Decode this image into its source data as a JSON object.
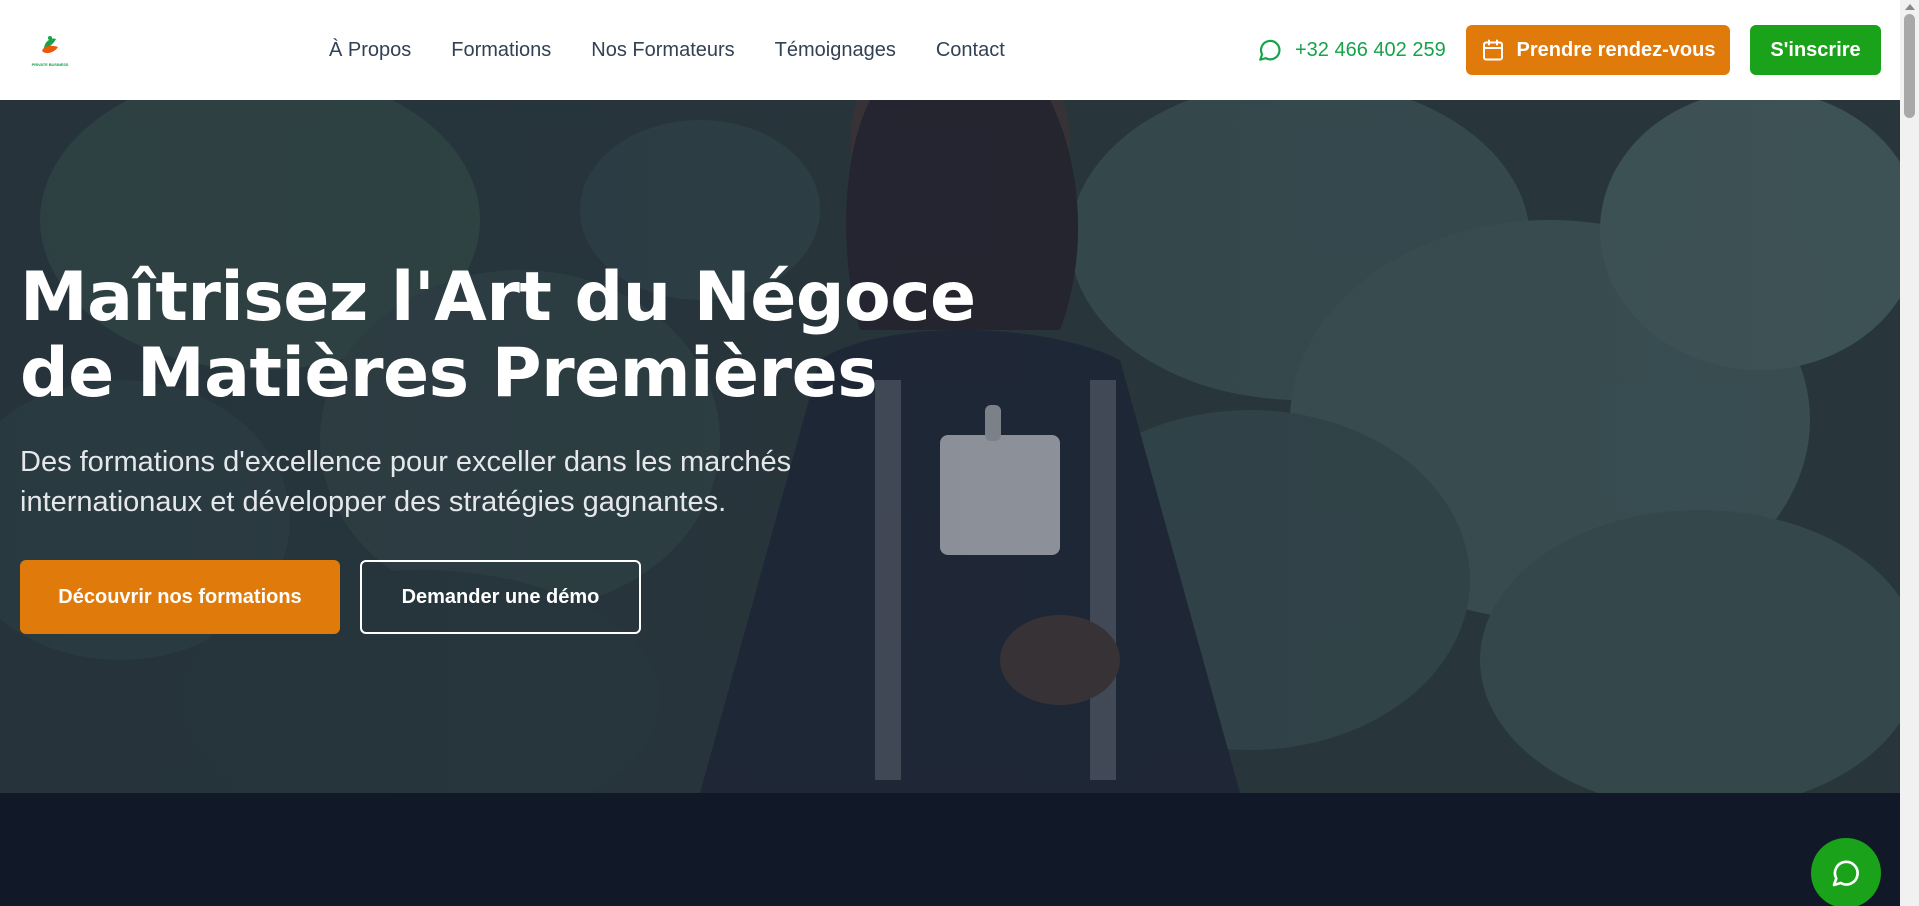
{
  "header": {
    "logo_text": "PRIVATE BUSINESS",
    "nav": [
      "À Propos",
      "Formations",
      "Nos Formateurs",
      "Témoignages",
      "Contact"
    ],
    "phone": "+32 466 402 259",
    "rdv_label": "Prendre rendez-vous",
    "inscrire_label": "S'inscrire"
  },
  "hero": {
    "title_line1": "Maîtrisez l'Art du Négoce",
    "title_line2": "de Matières Premières",
    "subtitle_line1": "Des formations d'excellence pour exceller dans les marchés",
    "subtitle_line2": "internationaux et développer des stratégies gagnantes.",
    "cta_primary": "Découvrir nos formations",
    "cta_secondary": "Demander une démo"
  },
  "icons": {
    "phone": "chat-bubble-icon",
    "calendar": "calendar-icon",
    "chat": "chat-bubble-icon"
  },
  "colors": {
    "accent_orange": "#e07a0a",
    "accent_green": "#1aa31a",
    "dark_section": "#111827"
  }
}
